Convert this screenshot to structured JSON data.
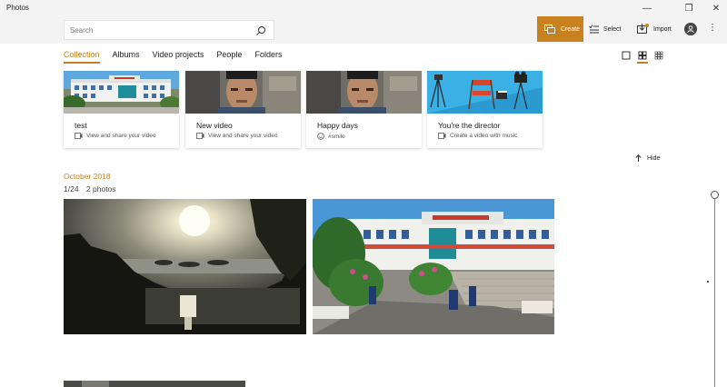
{
  "window": {
    "title": "Photos",
    "minimize_glyph": "—",
    "maximize_glyph": "❐",
    "close_glyph": "✕"
  },
  "search": {
    "placeholder": "Search",
    "value": ""
  },
  "commands": {
    "create": "Create",
    "select": "Select",
    "import": "Import",
    "more": "⋮"
  },
  "tabs": [
    {
      "label": "Collection",
      "active": true
    },
    {
      "label": "Albums",
      "active": false
    },
    {
      "label": "Video projects",
      "active": false
    },
    {
      "label": "People",
      "active": false
    },
    {
      "label": "Folders",
      "active": false
    }
  ],
  "cards": [
    {
      "title": "test",
      "subtitle": "View and share your video",
      "icon": "video-icon"
    },
    {
      "title": "New video",
      "subtitle": "View and share your video",
      "icon": "video-icon"
    },
    {
      "title": "Happy days",
      "subtitle": "#smile",
      "icon": "smiley-icon"
    },
    {
      "title": "You're the director",
      "subtitle": "Create a video with music",
      "icon": "video-icon"
    }
  ],
  "hide_label": "Hide",
  "group": {
    "heading": "October 2018",
    "date": "1/24",
    "count": "2 photos"
  },
  "colors": {
    "accent": "#c8811f",
    "titlebar": "#f3f3f3"
  }
}
